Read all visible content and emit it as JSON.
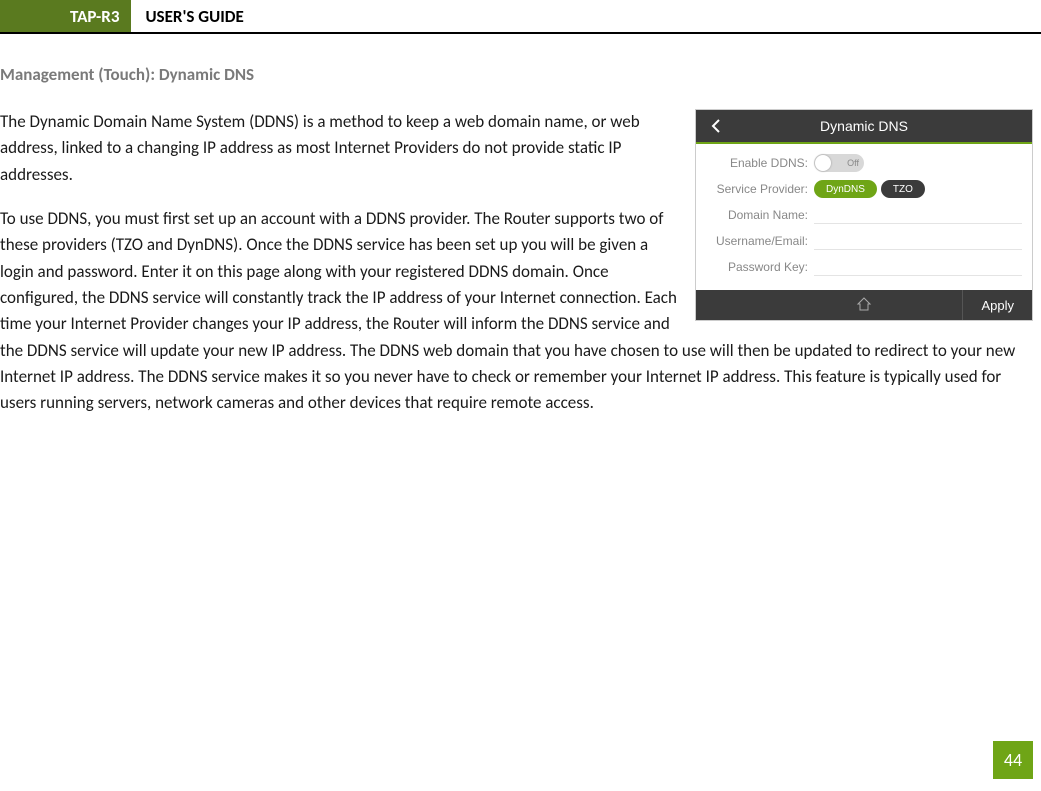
{
  "header": {
    "product": "TAP-R3",
    "guide": "USER'S GUIDE"
  },
  "section_title": "Management (Touch): Dynamic DNS",
  "paragraphs": [
    "The Dynamic Domain Name System (DDNS) is a method to keep a web domain name, or web address, linked to a changing IP address as most Internet Providers do not provide static IP addresses.",
    "To use DDNS, you must first set up an account with a DDNS provider. The Router supports two of these providers (TZO and DynDNS). Once the DDNS service has been set up you will be given a login and password.  Enter it on this page along with your registered DDNS domain.  Once configured, the DDNS service will constantly track the IP address of your Internet connection. Each time your Internet Provider changes your IP address, the Router will inform the DDNS service and the DDNS service will update your new IP address.  The DDNS web domain that you have chosen to use will then be updated to redirect to your new Internet IP address.  The DDNS service makes it so you never have to check or remember your Internet IP address. This feature is typically used for users running servers, network cameras and other devices that require remote access."
  ],
  "screenshot": {
    "title": "Dynamic DNS",
    "rows": {
      "enable": {
        "label": "Enable DDNS:",
        "toggle_text": "Off"
      },
      "provider": {
        "label": "Service Provider:",
        "opt1": "DynDNS",
        "opt2": "TZO"
      },
      "domain": {
        "label": "Domain Name:"
      },
      "user": {
        "label": "Username/Email:"
      },
      "pass": {
        "label": "Password Key:"
      }
    },
    "apply": "Apply"
  },
  "page_number": "44"
}
